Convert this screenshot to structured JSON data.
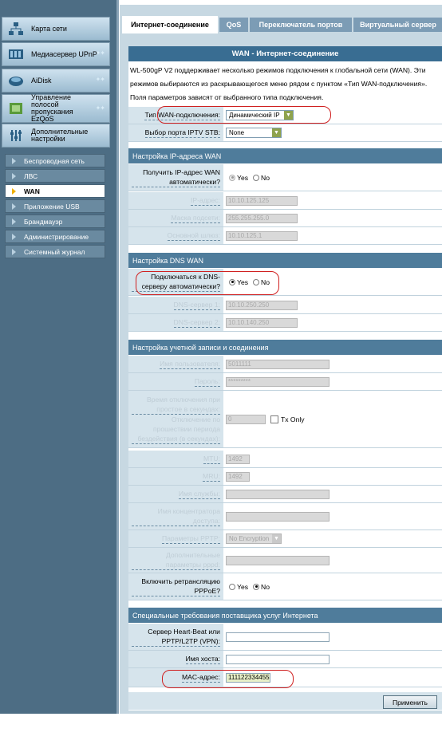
{
  "sidebar": {
    "main_items": [
      {
        "label": "Карта сети",
        "icon": "network-map-icon"
      },
      {
        "label": "Медиасервер UPnP",
        "icon": "media-server-icon"
      },
      {
        "label": "AiDisk",
        "icon": "aidisk-icon"
      },
      {
        "label": "Управление полосой пропускания EzQoS",
        "icon": "ezqos-icon"
      },
      {
        "label": "Дополнительные настройки",
        "icon": "advanced-settings-icon"
      }
    ],
    "sub_items": [
      {
        "label": "Беспроводная сеть"
      },
      {
        "label": "ЛВС"
      },
      {
        "label": "WAN",
        "active": true
      },
      {
        "label": "Приложение USB"
      },
      {
        "label": "Брандмауэр"
      },
      {
        "label": "Администрирование"
      },
      {
        "label": "Системный журнал"
      }
    ]
  },
  "tabs": [
    "Интернет-соединение",
    "QoS",
    "Переключатель портов",
    "Виртуальный сервер"
  ],
  "page": {
    "title": "WAN - Интернет-соединение",
    "description": "WL-500gP V2 поддерживает несколько режимов подключения к глобальной сети (WAN). Эти режимов выбираются из раскрывающегося меню рядом с пунктом «Тип WAN-подключения». Поля параметров зависят от выбранного типа подключения."
  },
  "connection": {
    "wan_type_label": "Тип WAN-подключения:",
    "wan_type_value": "Динамический IP",
    "iptv_label": "Выбор порта IPTV STB:",
    "iptv_value": "None"
  },
  "ip_section": {
    "header": "Настройка IP-адреса WAN",
    "auto_ip_label": "Получить IP-адрес WAN автоматически?",
    "yes": "Yes",
    "no": "No",
    "ip_label": "IP-адрес:",
    "ip_value": "10.10.125.125",
    "mask_label": "Маска подсети:",
    "mask_value": "255.255.255.0",
    "gateway_label": "Основной шлюз:",
    "gateway_value": "10.10.125.1"
  },
  "dns_section": {
    "header": "Настройка DNS WAN",
    "auto_dns_label": "Подключаться к DNS-серверу автоматически?",
    "yes": "Yes",
    "no": "No",
    "dns1_label": "DNS-сервер 1:",
    "dns1_value": "10.10.250.250",
    "dns2_label": "DNS-сервер 2:",
    "dns2_value": "10.10.140.250"
  },
  "account_section": {
    "header": "Настройка учетной записи и соединения",
    "username_label": "Имя пользователя:",
    "username_value": "5011111",
    "password_label": "Пароль:",
    "password_value": "*********",
    "idle_label_1": "Время отключения при простое в секундах:",
    "idle_label_2": "Отключение по прошествии периода бездействия (в секундах):",
    "idle_value": "0",
    "tx_only": "Tx Only",
    "mtu_label": "MTU:",
    "mtu_value": "1492",
    "mru_label": "MRU:",
    "mru_value": "1492",
    "service_label": "Имя службы:",
    "service_value": "",
    "concentrator_label": "Имя концентратора доступа:",
    "concentrator_value": "",
    "pptp_label": "Параметры PPTP:",
    "pptp_value": "No Encryption",
    "pppd_label": "Дополнительные параметры pppd:",
    "pppd_value": "",
    "relay_label": "Включить ретрансляцию PPPoE?",
    "yes": "Yes",
    "no": "No"
  },
  "isp_section": {
    "header": "Специальные требования поставщика услуг Интернета",
    "heartbeat_label": "Сервер Heart-Beat или PPTP/L2TP (VPN):",
    "heartbeat_value": "",
    "hostname_label": "Имя хоста:",
    "hostname_value": "",
    "mac_label": "MAC-адрес:",
    "mac_value": "111122334455"
  },
  "apply_label": "Применить",
  "colors": {
    "sidebar_bg": "#4d6d84",
    "section_header": "#4f7c9b",
    "page_header": "#396d92",
    "label_bg": "#d6e4ec",
    "highlight": "#d02020"
  }
}
